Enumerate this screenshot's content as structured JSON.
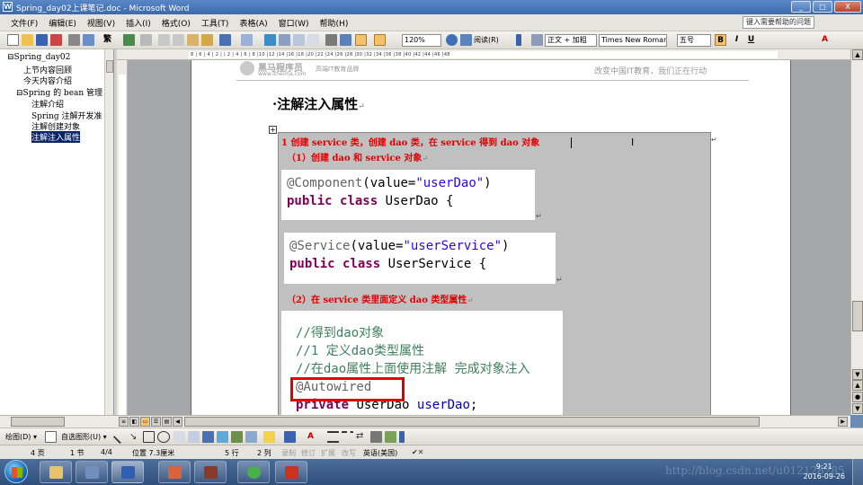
{
  "window": {
    "title": "Spring_day02上课笔记.doc - Microsoft Word",
    "app_icon": "W",
    "minimize_label": "_",
    "maximize_label": "□",
    "close_label": "X"
  },
  "menu": {
    "items": [
      "文件(F)",
      "编辑(E)",
      "视图(V)",
      "插入(I)",
      "格式(O)",
      "工具(T)",
      "表格(A)",
      "窗口(W)",
      "帮助(H)"
    ],
    "help_placeholder": "键入需要帮助的问题"
  },
  "toolbar": {
    "zoom": "120%",
    "read_label": "阅读(R)",
    "style": "正文 + 加粗",
    "font": "Times New Roman",
    "size": "五号",
    "bold": "B",
    "italic": "I",
    "underline": "U",
    "font_color": "A"
  },
  "docmap": {
    "nodes": [
      {
        "label": "⊟Spring_day02",
        "level": 0
      },
      {
        "label": "上节内容回顾",
        "level": 1
      },
      {
        "label": "今天内容介绍",
        "level": 1
      },
      {
        "label": "⊟Spring 的 bean 管理",
        "level": 1
      },
      {
        "label": "注解介绍",
        "level": 2
      },
      {
        "label": "Spring 注解开发准",
        "level": 2
      },
      {
        "label": "注解创建对象",
        "level": 2
      },
      {
        "label": "注解注入属性",
        "level": 2,
        "selected": true
      }
    ]
  },
  "ruler": {
    "numbers": "8 | 6 | 4 | 2 | | 2 | 4 | 6 | 8 |10 |12 |14 |16 |18 |20 |22 |24 |26 |28 |30 |32 |34 |36 |38 |40 |42 |44 |46 |48"
  },
  "page_header": {
    "logo_name": "黑马程序员",
    "logo_url": "www.itheima.com",
    "logo_sub": "高端IT教育品牌",
    "slogan": "改变中国IT教育，我们正在行动"
  },
  "document": {
    "heading": "·注解注入属性",
    "para_mark": "↵",
    "line1": "1  创建 service 类，创建 dao 类，在 service 得到 dao 对象",
    "line2": "（1）创建 dao 和 service 对象",
    "code1": {
      "annotation": "@Component",
      "open": "(value=",
      "value": "\"userDao\"",
      "close": ")",
      "kw1": "public",
      "kw2": "class",
      "name": "UserDao {"
    },
    "code2": {
      "annotation": "@Service",
      "open": "(value=",
      "value": "\"userService\"",
      "close": ")",
      "kw1": "public",
      "kw2": "class",
      "name": "UserService {"
    },
    "line3": "（2）在 service 类里面定义 dao 类型属性",
    "code3": {
      "comment1": "//得到dao对象",
      "comment2": "//1 定义dao类型属性",
      "comment3": "//在dao属性上面使用注解 完成对象注入",
      "annotation": "@Autowired",
      "kw": "private",
      "type": "UserDao",
      "field": "userDao",
      "end": ";"
    },
    "table_anchor": "+"
  },
  "drawbar": {
    "draw_label": "绘图(D) ▾",
    "autoshape_label": "自选图形(U) ▾"
  },
  "statusbar": {
    "page": "4 页",
    "section": "1 节",
    "page_of": "4/4",
    "position": "位置 7.3厘米",
    "line": "5 行",
    "col": "2 列",
    "rec": "录制",
    "trk": "修订",
    "ext": "扩展",
    "ovr": "改写",
    "lang": "英语(美国)"
  },
  "taskbar": {
    "time": "9:21",
    "date": "2016-09-26",
    "watermark": "http://blog.csdn.net/u012128285"
  },
  "colors": {
    "red_text": "#e00000",
    "selection": "#0a246a",
    "annotation": "#646464",
    "keyword": "#7f0055",
    "string": "#2a00ff",
    "comment": "#3f7f5f"
  }
}
